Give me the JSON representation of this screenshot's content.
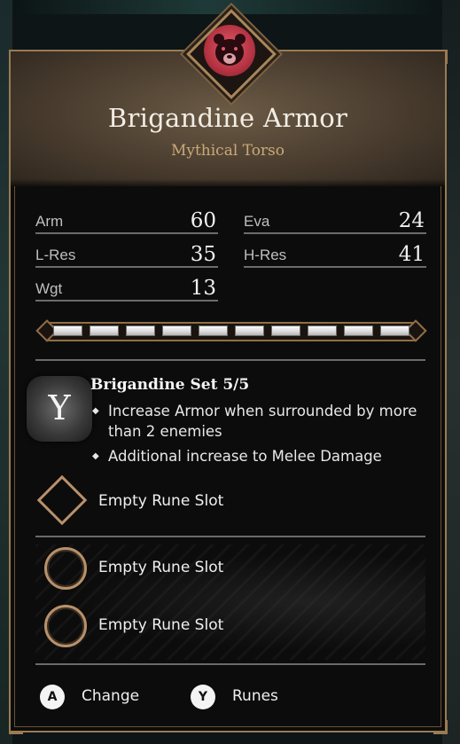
{
  "item": {
    "name": "Brigandine Armor",
    "category": "Mythical Torso",
    "emblem_icon": "bear-head-icon",
    "emblem_color": "#c23a4a"
  },
  "stats": [
    {
      "label": "Arm",
      "value": "60"
    },
    {
      "label": "Eva",
      "value": "24"
    },
    {
      "label": "L-Res",
      "value": "35"
    },
    {
      "label": "H-Res",
      "value": "41"
    },
    {
      "label": "Wgt",
      "value": "13"
    }
  ],
  "upgrade_track": {
    "filled": 10,
    "total": 10
  },
  "set_bonus": {
    "icon": "rune-set-icon",
    "glyph": "Y",
    "title": "Brigandine Set 5/5",
    "bullets": [
      "Increase Armor when surrounded by more than 2 enemies",
      "Additional increase to Melee Damage"
    ]
  },
  "rune_slots": [
    {
      "label": "Empty Rune Slot",
      "shape": "diamond"
    },
    {
      "label": "Empty Rune Slot",
      "shape": "circle"
    },
    {
      "label": "Empty Rune Slot",
      "shape": "circle"
    }
  ],
  "actions": [
    {
      "button": "A",
      "label": "Change"
    },
    {
      "button": "Y",
      "label": "Runes"
    }
  ]
}
